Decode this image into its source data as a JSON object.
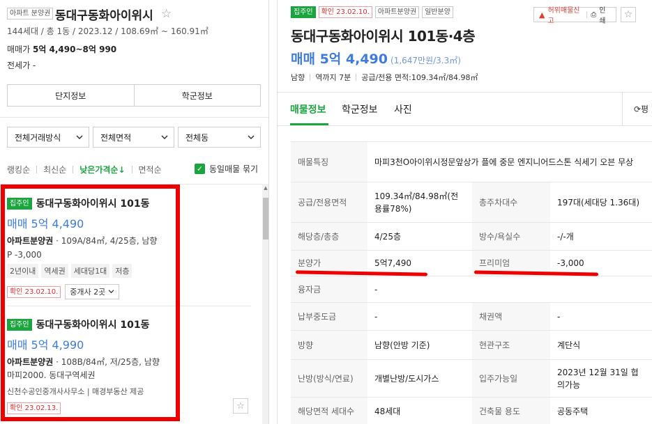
{
  "complex": {
    "tag": "아파트 분양권",
    "name": "동대구동화아이위시",
    "star": "☆",
    "meta": "144세대 / 총 1동 / 2023.12 / 108.69㎡ ~ 160.91㎡",
    "price_label": "매매가",
    "price_value": "5억 4,490~8억 990",
    "jeonse": "전세가 -",
    "tabs": [
      "단지정보",
      "학군정보"
    ]
  },
  "filters": [
    "전체거래방식",
    "전체면적",
    "전체동"
  ],
  "sort": {
    "items": [
      "랭킹순",
      "최신순",
      "낮은가격순↓",
      "면적순"
    ],
    "active_index": 2,
    "same_listing_label": "동일매물 묶기",
    "same_listing_checked": true
  },
  "listings": [
    {
      "badge": "집주인",
      "title": "동대구동화아이위시 101동",
      "price": "매매 5억 4,490",
      "type": "아파트분양권",
      "detail": " · 109A/84㎡, 4/25층, 남향",
      "extra": "P -3,000",
      "chips": [
        "2년이내",
        "역세권",
        "세대당1대",
        "저층"
      ],
      "confirm": "확인 23.02.10.",
      "broker": "중개사 2곳"
    },
    {
      "badge": "집주인",
      "title": "동대구동화아이위시 101동",
      "price": "매매 5억 4,990",
      "type": "아파트분양권",
      "detail": " · 108B/84㎡, 저/25층, 남향",
      "extra": "마피2000. 동대구역세권",
      "source": "신천수공인중개사사무소  |  매경부동산 제공",
      "confirm": "확인 23.02.13."
    }
  ],
  "detail": {
    "tags": [
      "집주인",
      "확인 23.02.10.",
      "아파트분양권",
      "일반분양"
    ],
    "actions": [
      "허위매물신고",
      "인쇄"
    ],
    "title": "동대구동화아이위시 101동·4층",
    "price": "매매 5억 4,490",
    "price_unit": "(1,647만원/3.3㎡)",
    "sub": [
      "남향",
      "역까지 7분",
      "공급/전용 면적:109.34㎡/84.98㎡"
    ],
    "tabs": [
      "매물정보",
      "학군정보",
      "사진"
    ],
    "refresh_label": "평",
    "rows": [
      {
        "h1": "매물특징",
        "v1": "마피3천O아이위시정문앞상가 플에 중문 엔지니어드스톤 식세기 오븐 무상"
      },
      {
        "h1": "공급/전용면적",
        "v1": "109.34㎡/84.98㎡(전용률78%)",
        "h2": "총주차대수",
        "v2": "197대(세대당 1.36대)"
      },
      {
        "h1": "해당층/총층",
        "v1": "4/25층",
        "h2": "방수/욕실수",
        "v2": "-/-개"
      },
      {
        "h1": "분양가",
        "v1": "5억7,490",
        "h2": "프리미엄",
        "v2": "-3,000"
      },
      {
        "h1": "융자금",
        "v1": "-"
      },
      {
        "h1": "납부중도금",
        "v1": "-",
        "h2": "채권액",
        "v2": "-"
      },
      {
        "h1": "방향",
        "v1": "남향(안방 기준)",
        "h2": "현관구조",
        "v2": "계단식"
      },
      {
        "h1": "난방(방식/연료)",
        "v1": "개별난방/도시가스",
        "h2": "입주가능일",
        "v2": "2023년 12월 31일 협의가능"
      },
      {
        "h1": "해당면적 세대수",
        "v1": "48세대",
        "h2": "건축물 용도",
        "v2": "공동주택"
      }
    ]
  },
  "colors": {
    "accent": "#1ba53f",
    "price": "#3d7be0",
    "highlight": "#ee0000"
  }
}
